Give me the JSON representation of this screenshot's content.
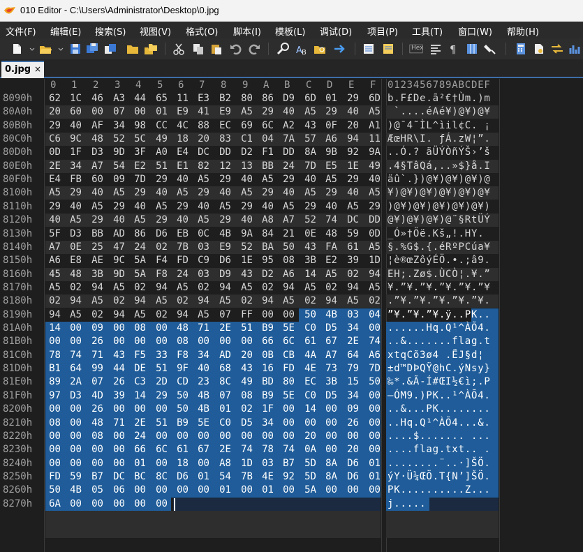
{
  "window": {
    "title": "010 Editor - C:\\Users\\Administrator\\Desktop\\0.jpg"
  },
  "menu": {
    "items": [
      "文件(F)",
      "编辑(E)",
      "搜索(S)",
      "视图(V)",
      "格式(O)",
      "脚本(I)",
      "模板(L)",
      "调试(D)",
      "项目(P)",
      "工具(T)",
      "窗口(W)",
      "帮助(H)"
    ]
  },
  "toolbar": {
    "hex_label": "Hex",
    "icons": [
      "new-file-icon",
      "open-folder-icon",
      "save-icon",
      "save-as-icon",
      "save-all-icon",
      "open-folder2-icon",
      "open-multiple-icon",
      "cut-icon",
      "copy-icon",
      "paste-icon",
      "undo-icon",
      "redo-icon",
      "find-icon",
      "replace-icon",
      "find-in-files-icon",
      "goto-icon",
      "compare-icon",
      "template-icon",
      "hex-mode-icon",
      "ruler-icon",
      "paragraph-icon",
      "columns-icon",
      "highlight-icon",
      "calculator-icon",
      "inspector-icon",
      "convert-icon",
      "histogram-icon"
    ]
  },
  "tab": {
    "label": "0.jpg",
    "close": "×"
  },
  "hex": {
    "column_header": [
      "0",
      "1",
      "2",
      "3",
      "4",
      "5",
      "6",
      "7",
      "8",
      "9",
      "A",
      "B",
      "C",
      "D",
      "E",
      "F"
    ],
    "ascii_header": "0123456789ABCDEF",
    "rows": [
      {
        "addr": "8090h",
        "bytes": [
          "62",
          "1C",
          "46",
          "A3",
          "44",
          "65",
          "11",
          "E3",
          "B2",
          "80",
          "86",
          "D9",
          "6D",
          "01",
          "29",
          "6D"
        ],
        "ascii": "b.F£De.ã²€†Ùm.)m"
      },
      {
        "addr": "80A0h",
        "bytes": [
          "20",
          "60",
          "00",
          "07",
          "00",
          "01",
          "E9",
          "41",
          "E9",
          "A5",
          "29",
          "40",
          "A5",
          "29",
          "40",
          "A5"
        ],
        "ascii": " `....éAé¥)@¥)@¥"
      },
      {
        "addr": "80B0h",
        "bytes": [
          "29",
          "40",
          "AF",
          "34",
          "98",
          "CC",
          "4C",
          "88",
          "EC",
          "69",
          "6C",
          "A2",
          "43",
          "0F",
          "20",
          "A1"
        ],
        "ascii": ")@¯4˜ÌL^ìil¢C. ¡"
      },
      {
        "addr": "80C0h",
        "bytes": [
          "C6",
          "9C",
          "48",
          "52",
          "5C",
          "49",
          "18",
          "20",
          "83",
          "C1",
          "04",
          "7A",
          "57",
          "A6",
          "94",
          "11"
        ],
        "ascii": "ÆœHR\\I. ƒÁ.zW¦”."
      },
      {
        "addr": "80D0h",
        "bytes": [
          "0D",
          "1F",
          "D3",
          "9D",
          "3F",
          "A0",
          "E4",
          "DC",
          "DD",
          "D2",
          "F1",
          "DD",
          "8A",
          "9B",
          "92",
          "9A"
        ],
        "ascii": "..Ó.? äÜÝÒñÝŠ›’š"
      },
      {
        "addr": "80E0h",
        "bytes": [
          "2E",
          "34",
          "A7",
          "54",
          "E2",
          "51",
          "E1",
          "82",
          "12",
          "13",
          "BB",
          "24",
          "7D",
          "E5",
          "1E",
          "49"
        ],
        "ascii": ".4§TâQá‚..»$}å.I"
      },
      {
        "addr": "80F0h",
        "bytes": [
          "E4",
          "FB",
          "60",
          "09",
          "7D",
          "29",
          "40",
          "A5",
          "29",
          "40",
          "A5",
          "29",
          "40",
          "A5",
          "29",
          "40"
        ],
        "ascii": "äû`.})@¥)@¥)@¥)@"
      },
      {
        "addr": "8100h",
        "bytes": [
          "A5",
          "29",
          "40",
          "A5",
          "29",
          "40",
          "A5",
          "29",
          "40",
          "A5",
          "29",
          "40",
          "A5",
          "29",
          "40",
          "A5"
        ],
        "ascii": "¥)@¥)@¥)@¥)@¥)@¥"
      },
      {
        "addr": "8110h",
        "bytes": [
          "29",
          "40",
          "A5",
          "29",
          "40",
          "A5",
          "29",
          "40",
          "A5",
          "29",
          "40",
          "A5",
          "29",
          "40",
          "A5",
          "29"
        ],
        "ascii": ")@¥)@¥)@¥)@¥)@¥)"
      },
      {
        "addr": "8120h",
        "bytes": [
          "40",
          "A5",
          "29",
          "40",
          "A5",
          "29",
          "40",
          "A5",
          "29",
          "40",
          "A8",
          "A7",
          "52",
          "74",
          "DC",
          "DD"
        ],
        "ascii": "@¥)@¥)@¥)@¨§RtÜÝ"
      },
      {
        "addr": "8130h",
        "bytes": [
          "5F",
          "D3",
          "BB",
          "AD",
          "86",
          "D6",
          "EB",
          "0C",
          "4B",
          "9A",
          "84",
          "21",
          "0E",
          "48",
          "59",
          "0D"
        ],
        "ascii": "_Ó»­†Öë.Kš„!.HY."
      },
      {
        "addr": "8140h",
        "bytes": [
          "A7",
          "0E",
          "25",
          "47",
          "24",
          "02",
          "7B",
          "03",
          "E9",
          "52",
          "BA",
          "50",
          "43",
          "FA",
          "61",
          "A5"
        ],
        "ascii": "§.%G$.{.éRºPCúa¥"
      },
      {
        "addr": "8150h",
        "bytes": [
          "A6",
          "E8",
          "AE",
          "9C",
          "5A",
          "F4",
          "FD",
          "C9",
          "D6",
          "1E",
          "95",
          "08",
          "3B",
          "E2",
          "39",
          "1D"
        ],
        "ascii": "¦è®œZôýÉÖ.•.;â9."
      },
      {
        "addr": "8160h",
        "bytes": [
          "45",
          "48",
          "3B",
          "9D",
          "5A",
          "F8",
          "24",
          "03",
          "D9",
          "43",
          "D2",
          "A6",
          "14",
          "A5",
          "02",
          "94"
        ],
        "ascii": "EH;.Zø$.ÙCÒ¦.¥.”"
      },
      {
        "addr": "8170h",
        "bytes": [
          "A5",
          "02",
          "94",
          "A5",
          "02",
          "94",
          "A5",
          "02",
          "94",
          "A5",
          "02",
          "94",
          "A5",
          "02",
          "94",
          "A5"
        ],
        "ascii": "¥.”¥.”¥.”¥.”¥.”¥"
      },
      {
        "addr": "8180h",
        "bytes": [
          "02",
          "94",
          "A5",
          "02",
          "94",
          "A5",
          "02",
          "94",
          "A5",
          "02",
          "94",
          "A5",
          "02",
          "94",
          "A5",
          "02"
        ],
        "ascii": ".”¥.”¥.”¥.”¥.”¥."
      },
      {
        "addr": "8190h",
        "bytes": [
          "94",
          "A5",
          "02",
          "94",
          "A5",
          "02",
          "94",
          "A5",
          "07",
          "FF",
          "00",
          "00",
          "50",
          "4B",
          "03",
          "04"
        ],
        "ascii": "”¥.”¥.”¥.ÿ..PK.."
      },
      {
        "addr": "81A0h",
        "bytes": [
          "14",
          "00",
          "09",
          "00",
          "08",
          "00",
          "48",
          "71",
          "2E",
          "51",
          "B9",
          "5E",
          "C0",
          "D5",
          "34",
          "00"
        ],
        "ascii": "......Hq.Q¹^ÀÕ4."
      },
      {
        "addr": "81B0h",
        "bytes": [
          "00",
          "00",
          "26",
          "00",
          "00",
          "00",
          "08",
          "00",
          "00",
          "00",
          "66",
          "6C",
          "61",
          "67",
          "2E",
          "74"
        ],
        "ascii": "..&.......flag.t"
      },
      {
        "addr": "81C0h",
        "bytes": [
          "78",
          "74",
          "71",
          "43",
          "F5",
          "33",
          "F8",
          "34",
          "AD",
          "20",
          "0B",
          "CB",
          "4A",
          "A7",
          "64",
          "A6"
        ],
        "ascii": "xtqCõ3ø4­ .ËJ§d¦"
      },
      {
        "addr": "81D0h",
        "bytes": [
          "B1",
          "64",
          "99",
          "44",
          "DE",
          "51",
          "9F",
          "40",
          "68",
          "43",
          "16",
          "FD",
          "4E",
          "73",
          "79",
          "7D"
        ],
        "ascii": "±d™DÞQŸ@hC.ýNsy}"
      },
      {
        "addr": "81E0h",
        "bytes": [
          "89",
          "2A",
          "07",
          "26",
          "C3",
          "2D",
          "CD",
          "23",
          "8C",
          "49",
          "BD",
          "80",
          "EC",
          "3B",
          "15",
          "50"
        ],
        "ascii": "‰*.&Ã-Í#ŒI½€ì;.P"
      },
      {
        "addr": "81F0h",
        "bytes": [
          "97",
          "D3",
          "4D",
          "39",
          "14",
          "29",
          "50",
          "4B",
          "07",
          "08",
          "B9",
          "5E",
          "C0",
          "D5",
          "34",
          "00"
        ],
        "ascii": "—ÓM9.)PK..¹^ÀÕ4."
      },
      {
        "addr": "8200h",
        "bytes": [
          "00",
          "00",
          "26",
          "00",
          "00",
          "00",
          "50",
          "4B",
          "01",
          "02",
          "1F",
          "00",
          "14",
          "00",
          "09",
          "00"
        ],
        "ascii": "..&...PK........"
      },
      {
        "addr": "8210h",
        "bytes": [
          "08",
          "00",
          "48",
          "71",
          "2E",
          "51",
          "B9",
          "5E",
          "C0",
          "D5",
          "34",
          "00",
          "00",
          "00",
          "26",
          "00"
        ],
        "ascii": "..Hq.Q¹^ÀÕ4...&."
      },
      {
        "addr": "8220h",
        "bytes": [
          "00",
          "00",
          "08",
          "00",
          "24",
          "00",
          "00",
          "00",
          "00",
          "00",
          "00",
          "00",
          "20",
          "00",
          "00",
          "00"
        ],
        "ascii": "....$....... ..."
      },
      {
        "addr": "8230h",
        "bytes": [
          "00",
          "00",
          "00",
          "00",
          "66",
          "6C",
          "61",
          "67",
          "2E",
          "74",
          "78",
          "74",
          "0A",
          "00",
          "20",
          "00"
        ],
        "ascii": "....flag.txt.. ."
      },
      {
        "addr": "8240h",
        "bytes": [
          "00",
          "00",
          "00",
          "00",
          "01",
          "00",
          "18",
          "00",
          "A8",
          "1D",
          "03",
          "B7",
          "5D",
          "8A",
          "D6",
          "01"
        ],
        "ascii": "........¨..·]ŠÖ."
      },
      {
        "addr": "8250h",
        "bytes": [
          "FD",
          "59",
          "B7",
          "DC",
          "BC",
          "8C",
          "D6",
          "01",
          "54",
          "7B",
          "4E",
          "92",
          "5D",
          "8A",
          "D6",
          "01"
        ],
        "ascii": "ýY·Ü¼ŒÖ.T{N’]ŠÖ."
      },
      {
        "addr": "8260h",
        "bytes": [
          "50",
          "4B",
          "05",
          "06",
          "00",
          "00",
          "00",
          "00",
          "01",
          "00",
          "01",
          "00",
          "5A",
          "00",
          "00",
          "00"
        ],
        "ascii": "PK..........Z..."
      },
      {
        "addr": "8270h",
        "bytes": [
          "6A",
          "00",
          "00",
          "00",
          "00",
          "00"
        ],
        "ascii": "j....."
      }
    ]
  },
  "colors": {
    "selection": "#1f5c99",
    "background": "#1e1e1e",
    "accent": "#3c6ea8"
  }
}
